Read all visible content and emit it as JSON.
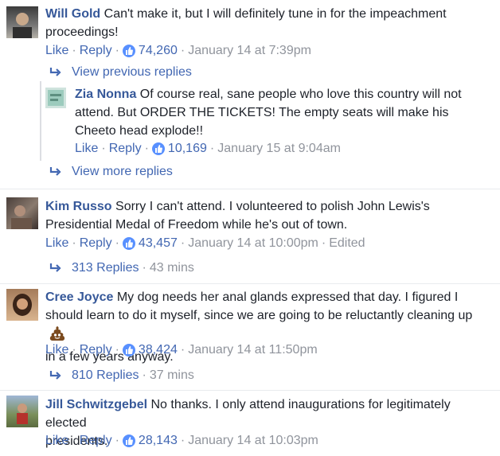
{
  "comments": [
    {
      "name": "Will Gold",
      "text_line1": "Can't make it, but I will definitely tune in for the impeachment",
      "text_line2": "proceedings!",
      "like": "Like",
      "reply": "Reply",
      "count": "74,260",
      "time": "January 14 at 7:39pm"
    },
    {
      "name": "Kim Russo",
      "text_line1": "Sorry I can't attend. I volunteered to polish John Lewis's",
      "text_line2": "Presidential Medal of Freedom while he's out of town.",
      "like": "Like",
      "reply": "Reply",
      "count": "43,457",
      "time": "January 14 at 10:00pm",
      "edited": "Edited",
      "replies": "313 Replies",
      "replies_time": "43 mins"
    },
    {
      "name": "Cree Joyce",
      "text_line1": "My dog needs her anal glands expressed that day. I figured I",
      "text_line2": "should learn to do it myself, since we are going to be reluctantly cleaning up",
      "text_line3": "in a few years anyway.",
      "like": "Like",
      "reply": "Reply",
      "count": "38,424",
      "time": "January 14 at 11:50pm",
      "replies": "810 Replies",
      "replies_time": "37 mins"
    },
    {
      "name": "Jill Schwitzgebel",
      "text_line1": "No thanks. I only attend inaugurations for legitimately elected",
      "text_line2": "presidents.",
      "like": "Like",
      "reply": "Reply",
      "count": "28,143",
      "time": "January 14 at 10:03pm"
    }
  ],
  "thread": {
    "view_previous": "View previous replies",
    "view_more": "View more replies",
    "reply": {
      "name": "Zia Nonna",
      "text_line1": "Of course real, sane people who love this country will not",
      "text_line2": "attend. But ORDER THE TICKETS! The empty seats will make his",
      "text_line3": "Cheeto head explode!!",
      "like": "Like",
      "reply": "Reply",
      "count": "10,169",
      "time": "January 15 at 9:04am"
    }
  },
  "colors": {
    "link": "#365899",
    "action": "#4267b2",
    "meta": "#90949c",
    "like_badge": "#5890ff"
  },
  "icons": [
    "like-icon",
    "reply-arrow-icon",
    "poop-emoji-icon"
  ]
}
